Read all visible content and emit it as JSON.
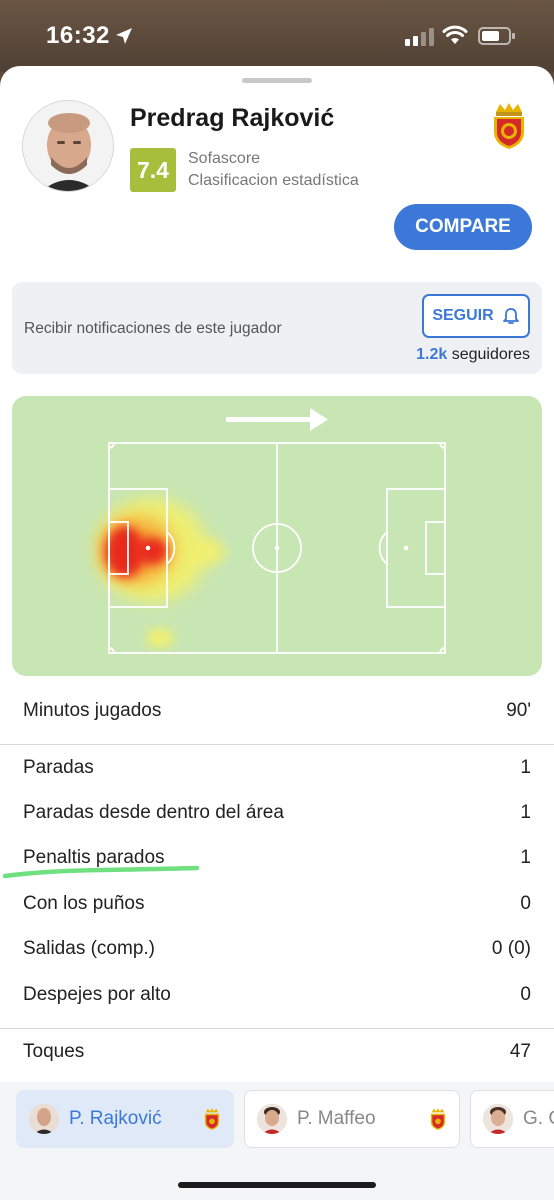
{
  "status_bar": {
    "time": "16:32",
    "icons": [
      "location-arrow-icon",
      "cellular-signal-icon",
      "wifi-icon",
      "battery-icon"
    ]
  },
  "header": {
    "player_name": "Predrag Rajković",
    "rating": "7.4",
    "rating_source": "Sofascore",
    "rating_description": "Clasificacion estadística",
    "compare_label": "COMPARE",
    "rating_color": "#a6be3c",
    "accent_color": "#3b78d8"
  },
  "follow": {
    "text": "Recibir notificaciones de este jugador",
    "button_label": "SEGUIR",
    "followers_count": "1.2k",
    "followers_label": "seguidores"
  },
  "stats": {
    "minutes": {
      "label": "Minutos jugados",
      "value": "90'"
    },
    "rows": [
      {
        "label": "Paradas",
        "value": "1"
      },
      {
        "label": "Paradas desde dentro del área",
        "value": "1"
      },
      {
        "label": "Penaltis parados",
        "value": "1"
      },
      {
        "label": "Con los puños",
        "value": "0"
      },
      {
        "label": "Salidas (comp.)",
        "value": "0 (0)"
      },
      {
        "label": "Despejes por alto",
        "value": "0"
      }
    ],
    "touches": {
      "label": "Toques",
      "value": "47"
    }
  },
  "player_bar": {
    "players": [
      {
        "name": "P. Rajković",
        "active": true
      },
      {
        "name": "P. Maffeo",
        "active": false
      },
      {
        "name": "G. G",
        "active": false
      }
    ]
  }
}
